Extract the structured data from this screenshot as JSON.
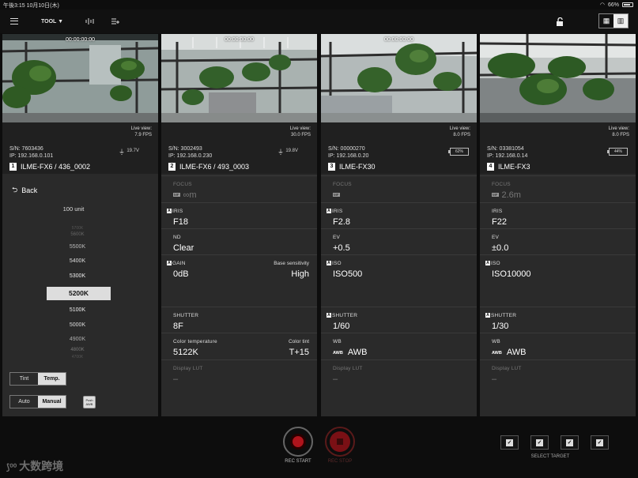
{
  "status": {
    "time_date": "午後3:15  10月10日(木)",
    "battery": "66%"
  },
  "toolbar": {
    "tool_label": "TOOL ▼"
  },
  "panels": [
    {
      "timecode": "00:00:00:00",
      "live_label": "Live view:",
      "fps": "7.9 FPS",
      "sn": "S/N: 7603436",
      "ip": "IP: 192.168.0.101",
      "power": "19.7V",
      "num": "1",
      "name": "ILME-FX6 / 436_0002"
    },
    {
      "timecode": "00:00:00:00",
      "live_label": "Live view:",
      "fps": "30.0 FPS",
      "sn": "S/N: 3002493",
      "ip": "IP: 192.168.0.230",
      "power": "19.8V",
      "num": "2",
      "name": "ILME-FX6 / 493_0003",
      "focus_label": "FOCUS",
      "focus_val": "∞m",
      "iris_label": "IRIS",
      "iris_val": "F18",
      "nd_label": "ND",
      "nd_val": "Clear",
      "gain_label": "GAIN",
      "gain_val": "0dB",
      "base_label": "Base sensitivity",
      "base_val": "High",
      "shutter_label": "SHUTTER",
      "shutter_val": "8F",
      "ct_label": "Color temperature",
      "ct_val": "5122K",
      "tint_label": "Color tint",
      "tint_val": "T+15",
      "lut_label": "Display LUT",
      "lut_val": "–"
    },
    {
      "timecode": "00:00:00:00",
      "live_label": "Live view:",
      "fps": "8.0 FPS",
      "sn": "S/N: 00000270",
      "ip": "IP: 192.168.0.20",
      "battery": "62%",
      "num": "3",
      "name": "ILME-FX30",
      "focus_label": "FOCUS",
      "iris_label": "IRIS",
      "iris_val": "F2.8",
      "ev_label": "EV",
      "ev_val": "+0.5",
      "iso_label": "ISO",
      "iso_val": "ISO500",
      "shutter_label": "SHUTTER",
      "shutter_val": "1/60",
      "wb_label": "WB",
      "wb_val": "AWB",
      "lut_label": "Display LUT",
      "lut_val": "–"
    },
    {
      "live_label": "Live view:",
      "fps": "8.0 FPS",
      "sn": "S/N: 03381054",
      "ip": "IP: 192.168.0.14",
      "battery": "44%",
      "num": "4",
      "name": "ILME-FX3",
      "focus_label": "FOCUS",
      "focus_val": "2.6m",
      "iris_label": "IRIS",
      "iris_val": "F22",
      "ev_label": "EV",
      "ev_val": "±0.0",
      "iso_label": "ISO",
      "iso_val": "ISO10000",
      "shutter_label": "SHUTTER",
      "shutter_val": "1/30",
      "wb_label": "WB",
      "wb_val": "AWB",
      "lut_label": "Display LUT",
      "lut_val": "–"
    }
  ],
  "wb_panel": {
    "back": "Back",
    "step": "100 unit",
    "kelvin_above": [
      "5700K",
      "5600K",
      "5500K",
      "5400K",
      "5300K"
    ],
    "kelvin_selected": "5200K",
    "kelvin_below": [
      "5100K",
      "5000K",
      "4900K",
      "4800K",
      "4700K"
    ],
    "tint": "Tint",
    "temp": "Temp.",
    "auto": "Auto",
    "manual": "Manual",
    "push_awb": "Push AWB"
  },
  "badges": {
    "a": "A",
    "mf": "MF",
    "awb": "AWB"
  },
  "rec": {
    "start": "REC START",
    "stop": "REC STOP"
  },
  "select_target": "SELECT TARGET",
  "watermark": "大数跨境"
}
